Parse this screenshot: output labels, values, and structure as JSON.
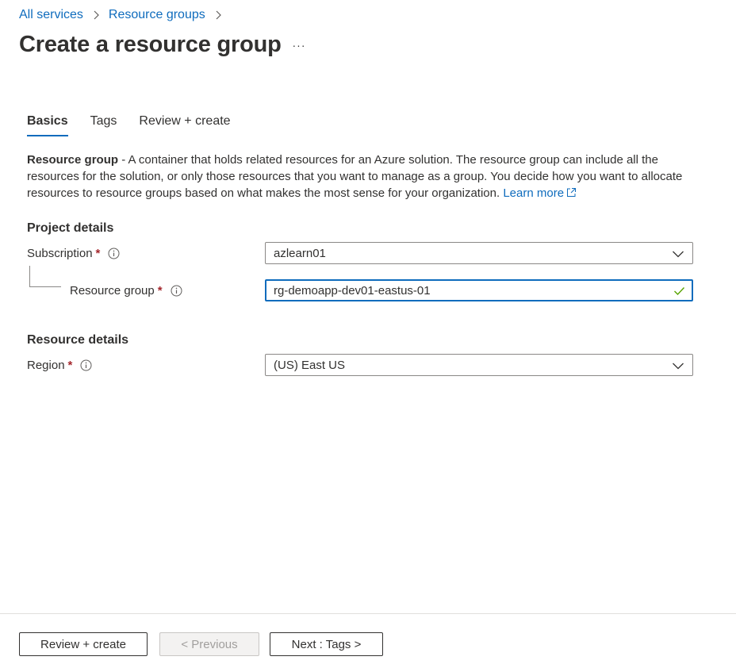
{
  "breadcrumb": {
    "items": [
      {
        "label": "All services"
      },
      {
        "label": "Resource groups"
      }
    ]
  },
  "page": {
    "title": "Create a resource group",
    "more_label": "···"
  },
  "tabs": [
    {
      "label": "Basics",
      "active": true
    },
    {
      "label": "Tags",
      "active": false
    },
    {
      "label": "Review + create",
      "active": false
    }
  ],
  "description": {
    "term": "Resource group",
    "text": " - A container that holds related resources for an Azure solution. The resource group can include all the resources for the solution, or only those resources that you want to manage as a group. You decide how you want to allocate resources to resource groups based on what makes the most sense for your organization. ",
    "link": "Learn more"
  },
  "project_details": {
    "title": "Project details",
    "subscription": {
      "label": "Subscription",
      "required_mark": "*",
      "value": "azlearn01",
      "icon": "chevron-down-icon"
    },
    "resource_group": {
      "label": "Resource group",
      "required_mark": "*",
      "value": "rg-demoapp-dev01-eastus-01",
      "status": "valid",
      "icon": "checkmark-icon"
    }
  },
  "resource_details": {
    "title": "Resource details",
    "region": {
      "label": "Region",
      "required_mark": "*",
      "value": "(US) East US",
      "icon": "chevron-down-icon"
    }
  },
  "footer": {
    "review_create": "Review + create",
    "previous": "< Previous",
    "next": "Next : Tags >"
  },
  "colors": {
    "link": "#0f6cbd",
    "required": "#a4262c",
    "valid_check": "#57a300",
    "focus_border": "#0f6cbd"
  }
}
